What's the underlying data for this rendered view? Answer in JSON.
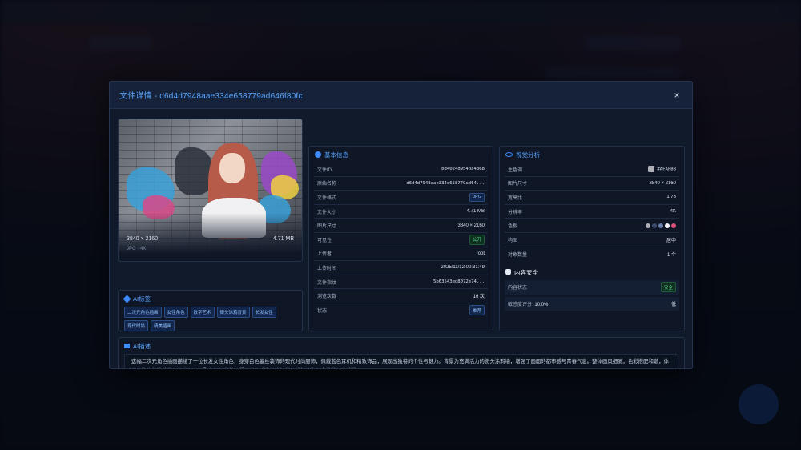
{
  "modal": {
    "title": "文件详情 - d6d4d7948aae334e658779ad646f80fc",
    "close_label": "×"
  },
  "preview": {
    "dimensions": "3840 × 2160",
    "size": "4.71 MB",
    "format_line": "JPG · 4K"
  },
  "ai_tags": {
    "title": "AI标签",
    "tags": [
      "二次元角色插画",
      "女性角色",
      "数字艺术",
      "街头涂鸦背景",
      "长发女性",
      "现代时尚",
      "精美插画"
    ]
  },
  "basic_info": {
    "title": "基本信息",
    "rows": [
      {
        "label": "文件ID",
        "value": "bd4024d954ba4868"
      },
      {
        "label": "原始名称",
        "value": "d6d4d7948aae334e658779ad64..."
      },
      {
        "label": "文件格式",
        "value": "JPG"
      },
      {
        "label": "文件大小",
        "value": "4.71 MB"
      },
      {
        "label": "图片尺寸",
        "value": "3840 × 2160"
      },
      {
        "label": "可见性",
        "value": "公开"
      },
      {
        "label": "上传者",
        "value": "root"
      },
      {
        "label": "上传时间",
        "value": "2025/11/12 00:31:49"
      },
      {
        "label": "文件指纹",
        "value": "5b63543ed8072e74..."
      },
      {
        "label": "浏览次数",
        "value": "16 次"
      },
      {
        "label": "状态",
        "value": "推荐"
      }
    ]
  },
  "visual": {
    "title": "视觉分析",
    "rows": [
      {
        "label": "主色调",
        "value": "#AFAFB8"
      },
      {
        "label": "图片尺寸",
        "value": "3840 × 2160"
      },
      {
        "label": "宽高比",
        "value": "1.78"
      },
      {
        "label": "分辨率",
        "value": "4K"
      },
      {
        "label": "色板",
        "value": ""
      },
      {
        "label": "构图",
        "value": "居中"
      },
      {
        "label": "对象数量",
        "value": "1 个"
      }
    ],
    "main_color": "#AFAFB8",
    "palette": [
      "#AFAFB8",
      "#3b4b6a",
      "#6a7fa8",
      "#f2f2f4",
      "#e0507a"
    ]
  },
  "safety": {
    "title": "内容安全",
    "status_label": "内容状态",
    "status_value": "安全",
    "score_label": "敏感度评分",
    "score_value": "10.0%",
    "score_level": "低"
  },
  "description": {
    "title": "AI描述",
    "text": "这幅二次元角色插画描绘了一位长发女性角色，身穿白色蕾丝装饰的现代时尚服饰，佩戴蓝色耳机和精致饰品，展现出独特的个性与魅力。背景为充满活力的街头涂鸦墙，增强了画面的都市感与青春气息。整体画风细腻，色彩搭配和谐，体现了数字艺术的高水平表现力，融合了现实与幻想元素，适合喜欢现代风格与二次元文化的观众欣赏。"
  }
}
